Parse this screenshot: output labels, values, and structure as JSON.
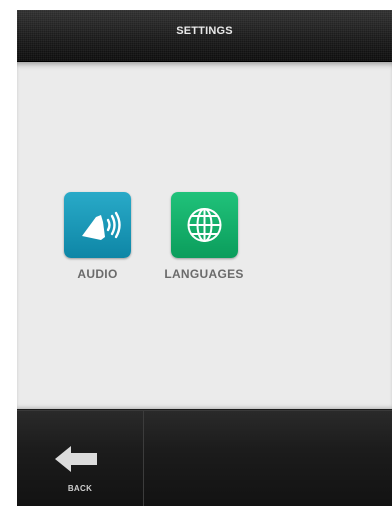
{
  "header": {
    "title": "SETTINGS"
  },
  "tiles": [
    {
      "label": "AUDIO",
      "icon": "speaker-icon",
      "color": "#1597b8"
    },
    {
      "label": "LANGUAGES",
      "icon": "globe-icon",
      "color": "#14ad6a"
    }
  ],
  "footer": {
    "back_label": "BACK",
    "back_icon": "back-arrow-icon"
  },
  "colors": {
    "background": "#ebebeb",
    "bar": "#1b1b1b",
    "label_text": "#6b6b6b"
  }
}
